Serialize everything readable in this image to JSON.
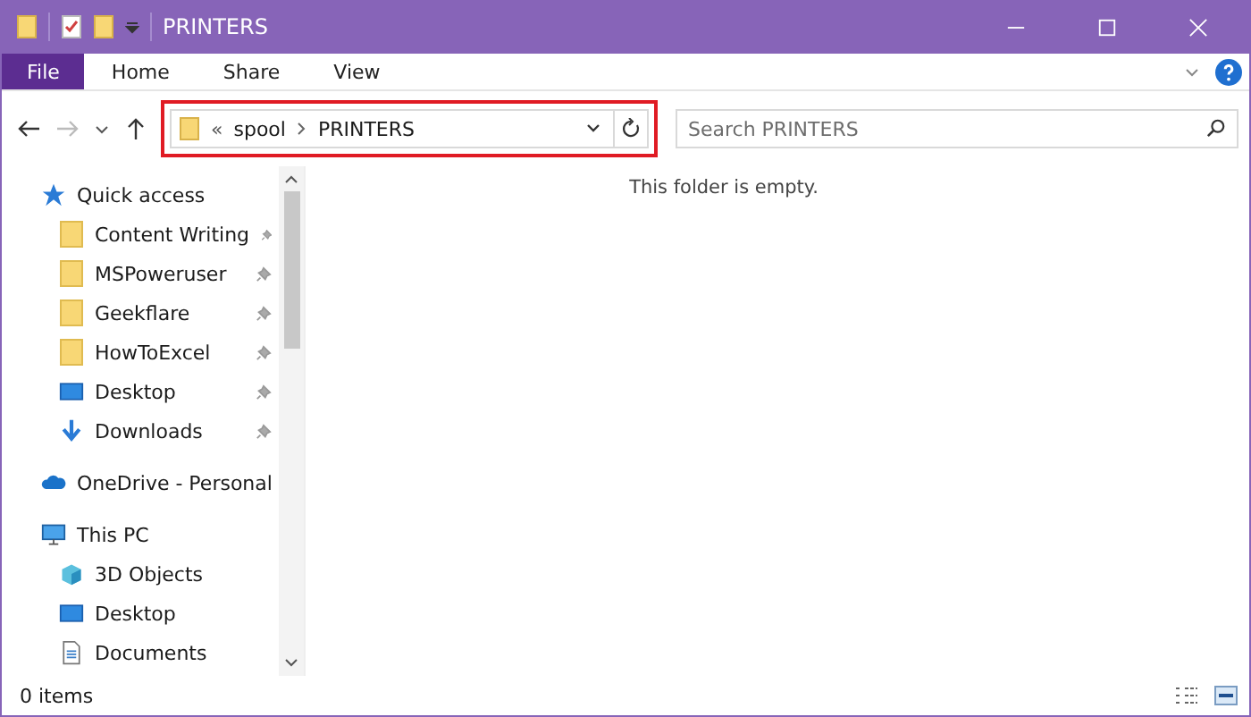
{
  "window": {
    "title": "PRINTERS"
  },
  "ribbon_tabs": [
    {
      "label": "File",
      "selected": true
    },
    {
      "label": "Home",
      "selected": false
    },
    {
      "label": "Share",
      "selected": false
    },
    {
      "label": "View",
      "selected": false
    }
  ],
  "address": {
    "overflow": "«",
    "path": [
      "spool",
      "PRINTERS"
    ],
    "highlighted": true
  },
  "search": {
    "placeholder": "Search PRINTERS"
  },
  "sidebar": {
    "items": [
      {
        "label": "Quick access",
        "kind": "star",
        "children": [
          {
            "label": "Content Writing",
            "kind": "folder",
            "pinned": true
          },
          {
            "label": "MSPoweruser",
            "kind": "folder",
            "pinned": true
          },
          {
            "label": "Geekflare",
            "kind": "folder",
            "pinned": true
          },
          {
            "label": "HowToExcel",
            "kind": "folder",
            "pinned": true
          },
          {
            "label": "Desktop",
            "kind": "desktop",
            "pinned": true
          },
          {
            "label": "Downloads",
            "kind": "download",
            "pinned": true
          }
        ]
      },
      {
        "label": "OneDrive - Personal",
        "kind": "cloud"
      },
      {
        "label": "This PC",
        "kind": "pc",
        "children": [
          {
            "label": "3D Objects",
            "kind": "cube"
          },
          {
            "label": "Desktop",
            "kind": "desktop"
          },
          {
            "label": "Documents",
            "kind": "document"
          }
        ]
      }
    ]
  },
  "content": {
    "empty_message": "This folder is empty."
  },
  "status_bar": {
    "item_count": "0 items"
  }
}
